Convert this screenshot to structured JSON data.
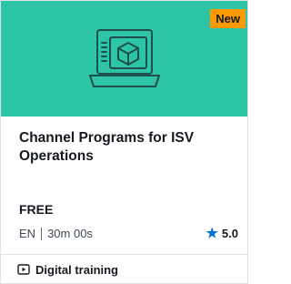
{
  "card": {
    "badge": "New",
    "title": "Channel Programs for ISV Operations",
    "price": "FREE",
    "language": "EN",
    "duration": "30m 00s",
    "rating": "5.0",
    "type_label": "Digital training",
    "icons": {
      "banner": "laptop-cube-icon",
      "rating": "star-icon",
      "type": "video-play-icon"
    },
    "colors": {
      "banner": "#2ec4a6",
      "badge": "#ff9900",
      "star": "#0972d3"
    }
  }
}
